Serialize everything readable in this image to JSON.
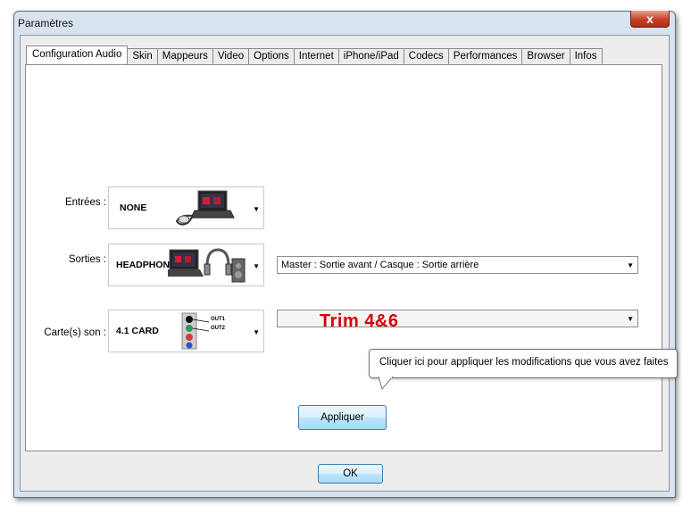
{
  "window": {
    "title": "Paramètres",
    "close_label": "x"
  },
  "tabs": [
    {
      "label": "Configuration Audio",
      "active": true
    },
    {
      "label": "Skin"
    },
    {
      "label": "Mappeurs"
    },
    {
      "label": "Video"
    },
    {
      "label": "Options"
    },
    {
      "label": "Internet"
    },
    {
      "label": "iPhone/iPad"
    },
    {
      "label": "Codecs"
    },
    {
      "label": "Performances"
    },
    {
      "label": "Browser"
    },
    {
      "label": "Infos"
    }
  ],
  "audio": {
    "inputs": {
      "label": "Entrées :",
      "value": "NONE"
    },
    "outputs": {
      "label": "Sorties :",
      "value": "HEADPHONES",
      "mode_value": "Master : Sortie avant / Casque : Sortie arrière"
    },
    "cards": {
      "label": "Carte(s) son :",
      "value": "4.1 CARD",
      "out1": "OUT1",
      "out2": "OUT2",
      "device_value": "Trim 4&6"
    }
  },
  "apply_button": "Appliquer",
  "tooltip": "Cliquer ici pour appliquer les modifications que vous avez faites",
  "ok_button": "OK",
  "colors": {
    "tooltip_trim_text": "#d40000",
    "button_border": "#3c7fb1"
  }
}
